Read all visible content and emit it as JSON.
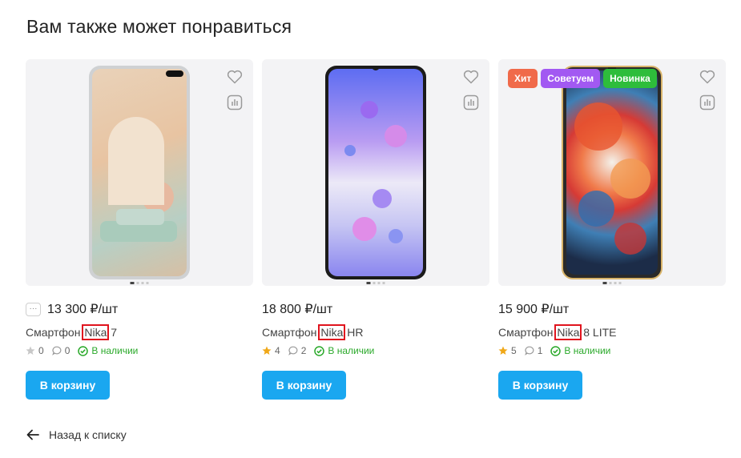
{
  "page_title": "Вам также может понравиться",
  "products": [
    {
      "price": "13 300 ₽/шт",
      "name_prefix": "Смартфон ",
      "name_highlight": "Nika",
      "name_suffix": " 7",
      "rating": "0",
      "comments": "0",
      "stock": "В наличии",
      "cart_label": "В корзину",
      "star_color": "#c8c8c8",
      "badges": []
    },
    {
      "price": "18 800 ₽/шт",
      "name_prefix": "Смартфон ",
      "name_highlight": "Nika",
      "name_suffix": " HR",
      "rating": "4",
      "comments": "2",
      "stock": "В наличии",
      "cart_label": "В корзину",
      "star_color": "#f0a818",
      "badges": []
    },
    {
      "price": "15 900 ₽/шт",
      "name_prefix": "Смартфон ",
      "name_highlight": "Nika",
      "name_suffix": " 8 LITE",
      "rating": "5",
      "comments": "1",
      "stock": "В наличии",
      "cart_label": "В корзину",
      "star_color": "#f0a818",
      "badges": [
        {
          "label": "Хит",
          "color": "#f06a4a"
        },
        {
          "label": "Советуем",
          "color": "#a259f2"
        },
        {
          "label": "Новинка",
          "color": "#2ebd3b"
        }
      ]
    }
  ],
  "more_icon": "ellipsis-icon",
  "back_label": "Назад к списку",
  "colors": {
    "accent": "#1aa7f0",
    "in_stock": "#2aa92a",
    "highlight_box": "#e0141e"
  }
}
